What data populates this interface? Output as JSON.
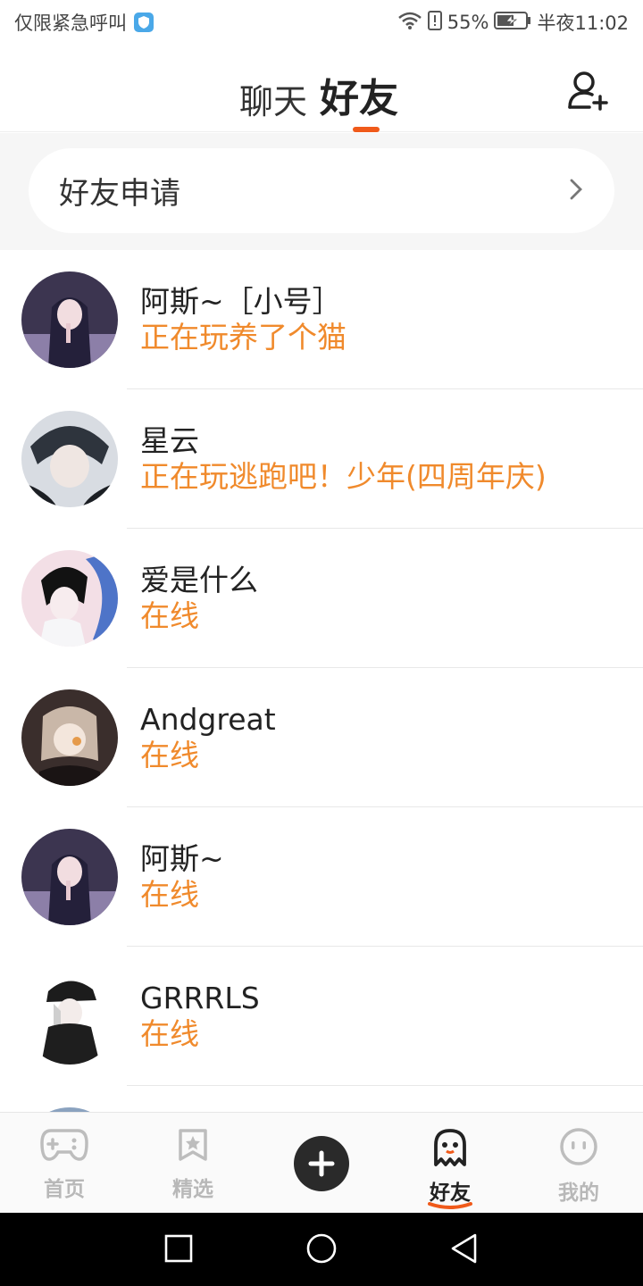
{
  "status_bar": {
    "emergency_text": "仅限紧急呼叫",
    "battery_percent": "55%",
    "time": "半夜11:02"
  },
  "header": {
    "tab_chat": "聊天",
    "tab_friends": "好友",
    "active_tab": "好友"
  },
  "friend_request": {
    "label": "好友申请"
  },
  "friends": [
    {
      "name": "阿斯~［小号］",
      "status": "正在玩养了个猫"
    },
    {
      "name": "星云",
      "status": "正在玩逃跑吧！少年(四周年庆)"
    },
    {
      "name": "爱是什么",
      "status": "在线"
    },
    {
      "name": "Andgreat",
      "status": "在线"
    },
    {
      "name": "阿斯~",
      "status": "在线"
    },
    {
      "name": "GRRRLS",
      "status": "在线"
    }
  ],
  "bottom_nav": {
    "home": "首页",
    "featured": "精选",
    "friends": "好友",
    "me": "我的",
    "active": "好友"
  },
  "colors": {
    "accent": "#f05a1a",
    "status_orange": "#f08a2c"
  }
}
